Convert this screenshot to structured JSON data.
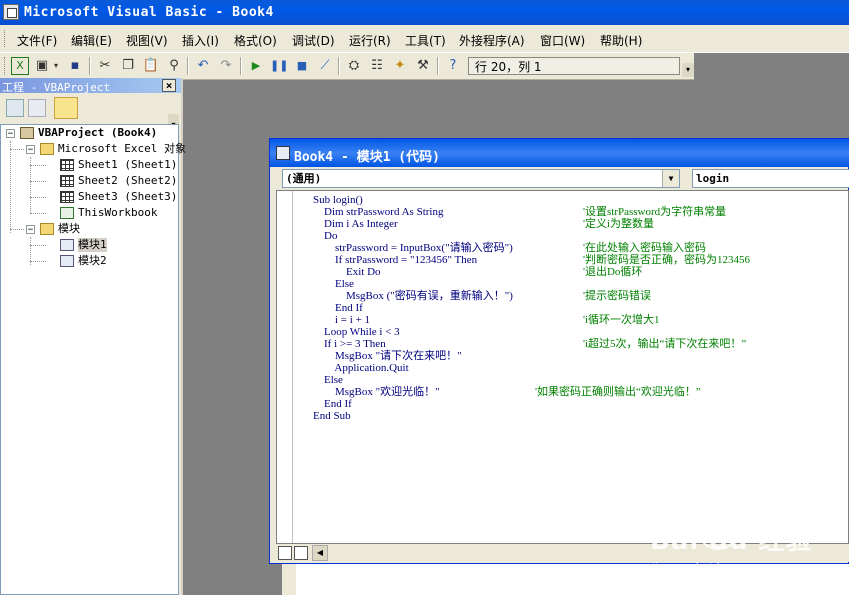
{
  "window": {
    "title": "Microsoft Visual Basic - Book4"
  },
  "menu": [
    "文件(F)",
    "编辑(E)",
    "视图(V)",
    "插入(I)",
    "格式(O)",
    "调试(D)",
    "运行(R)",
    "工具(T)",
    "外接程序(A)",
    "窗口(W)",
    "帮助(H)"
  ],
  "toolbar": {
    "icons": [
      "excel-icon",
      "insert-userform-icon",
      "dropdown-arrow-icon",
      "save-icon",
      "cut-icon",
      "copy-icon",
      "paste-icon",
      "find-icon",
      "undo-icon",
      "redo-icon",
      "run-icon",
      "break-icon",
      "reset-icon",
      "design-mode-icon",
      "project-explorer-icon",
      "properties-icon",
      "object-browser-icon",
      "toolbox-icon",
      "help-icon"
    ],
    "position": "行 20，列 1"
  },
  "project": {
    "title": "工程 - VBAProject",
    "tree": {
      "root": "VBAProject (Book4)",
      "excel_folder": "Microsoft Excel 对象",
      "sheets": [
        "Sheet1 (Sheet1)",
        "Sheet2 (Sheet2)",
        "Sheet3 (Sheet3)"
      ],
      "workbook": "ThisWorkbook",
      "modules_folder": "模块",
      "modules": [
        "模块1",
        "模块2"
      ]
    }
  },
  "codewin": {
    "title": "Book4 - 模块1 (代码)",
    "object_combo": "(通用)",
    "proc_combo": "login",
    "lines": [
      {
        "code": "Sub login()",
        "comment": ""
      },
      {
        "code": "    Dim strPassword As String",
        "comment": "'设置strPassword为字符串常量"
      },
      {
        "code": "    Dim i As Integer",
        "comment": "'定义i为整数量"
      },
      {
        "code": "    Do",
        "comment": ""
      },
      {
        "code": "        strPassword = InputBox(\"请输入密码\")",
        "comment": "'在此处输入密码输入密码"
      },
      {
        "code": "        If strPassword = \"123456\" Then",
        "comment": "'判断密码是否正确，密码为123456"
      },
      {
        "code": "            Exit Do",
        "comment": "'退出Do循环"
      },
      {
        "code": "        Else",
        "comment": ""
      },
      {
        "code": "            MsgBox (\"密码有误，重新输入！\")",
        "comment": "'提示密码错误"
      },
      {
        "code": "        End If",
        "comment": ""
      },
      {
        "code": "        i = i + 1",
        "comment": "'i循环一次增大1"
      },
      {
        "code": "    Loop While i < 3",
        "comment": ""
      },
      {
        "code": "    If i >= 3 Then",
        "comment": "'i超过5次，输出“请下次在来吧！”"
      },
      {
        "code": "        MsgBox \"请下次在来吧！\"",
        "comment": ""
      },
      {
        "code": "        Application.Quit",
        "comment": ""
      },
      {
        "code": "    Else",
        "comment": ""
      },
      {
        "code": "        MsgBox \"欢迎光临！\"",
        "comment": "'如果密码正确则输出“欢迎光临！”"
      },
      {
        "code": "    End If",
        "comment": ""
      },
      {
        "code": "End Sub",
        "comment": ""
      }
    ]
  },
  "watermark": {
    "main": "Bai du 经验",
    "sub": "jingyan.baidu.com"
  },
  "colors": {
    "title_blue": "#0058e6",
    "keyword_blue": "#00007f",
    "comment_green": "#008000",
    "workspace_gray": "#808080"
  }
}
